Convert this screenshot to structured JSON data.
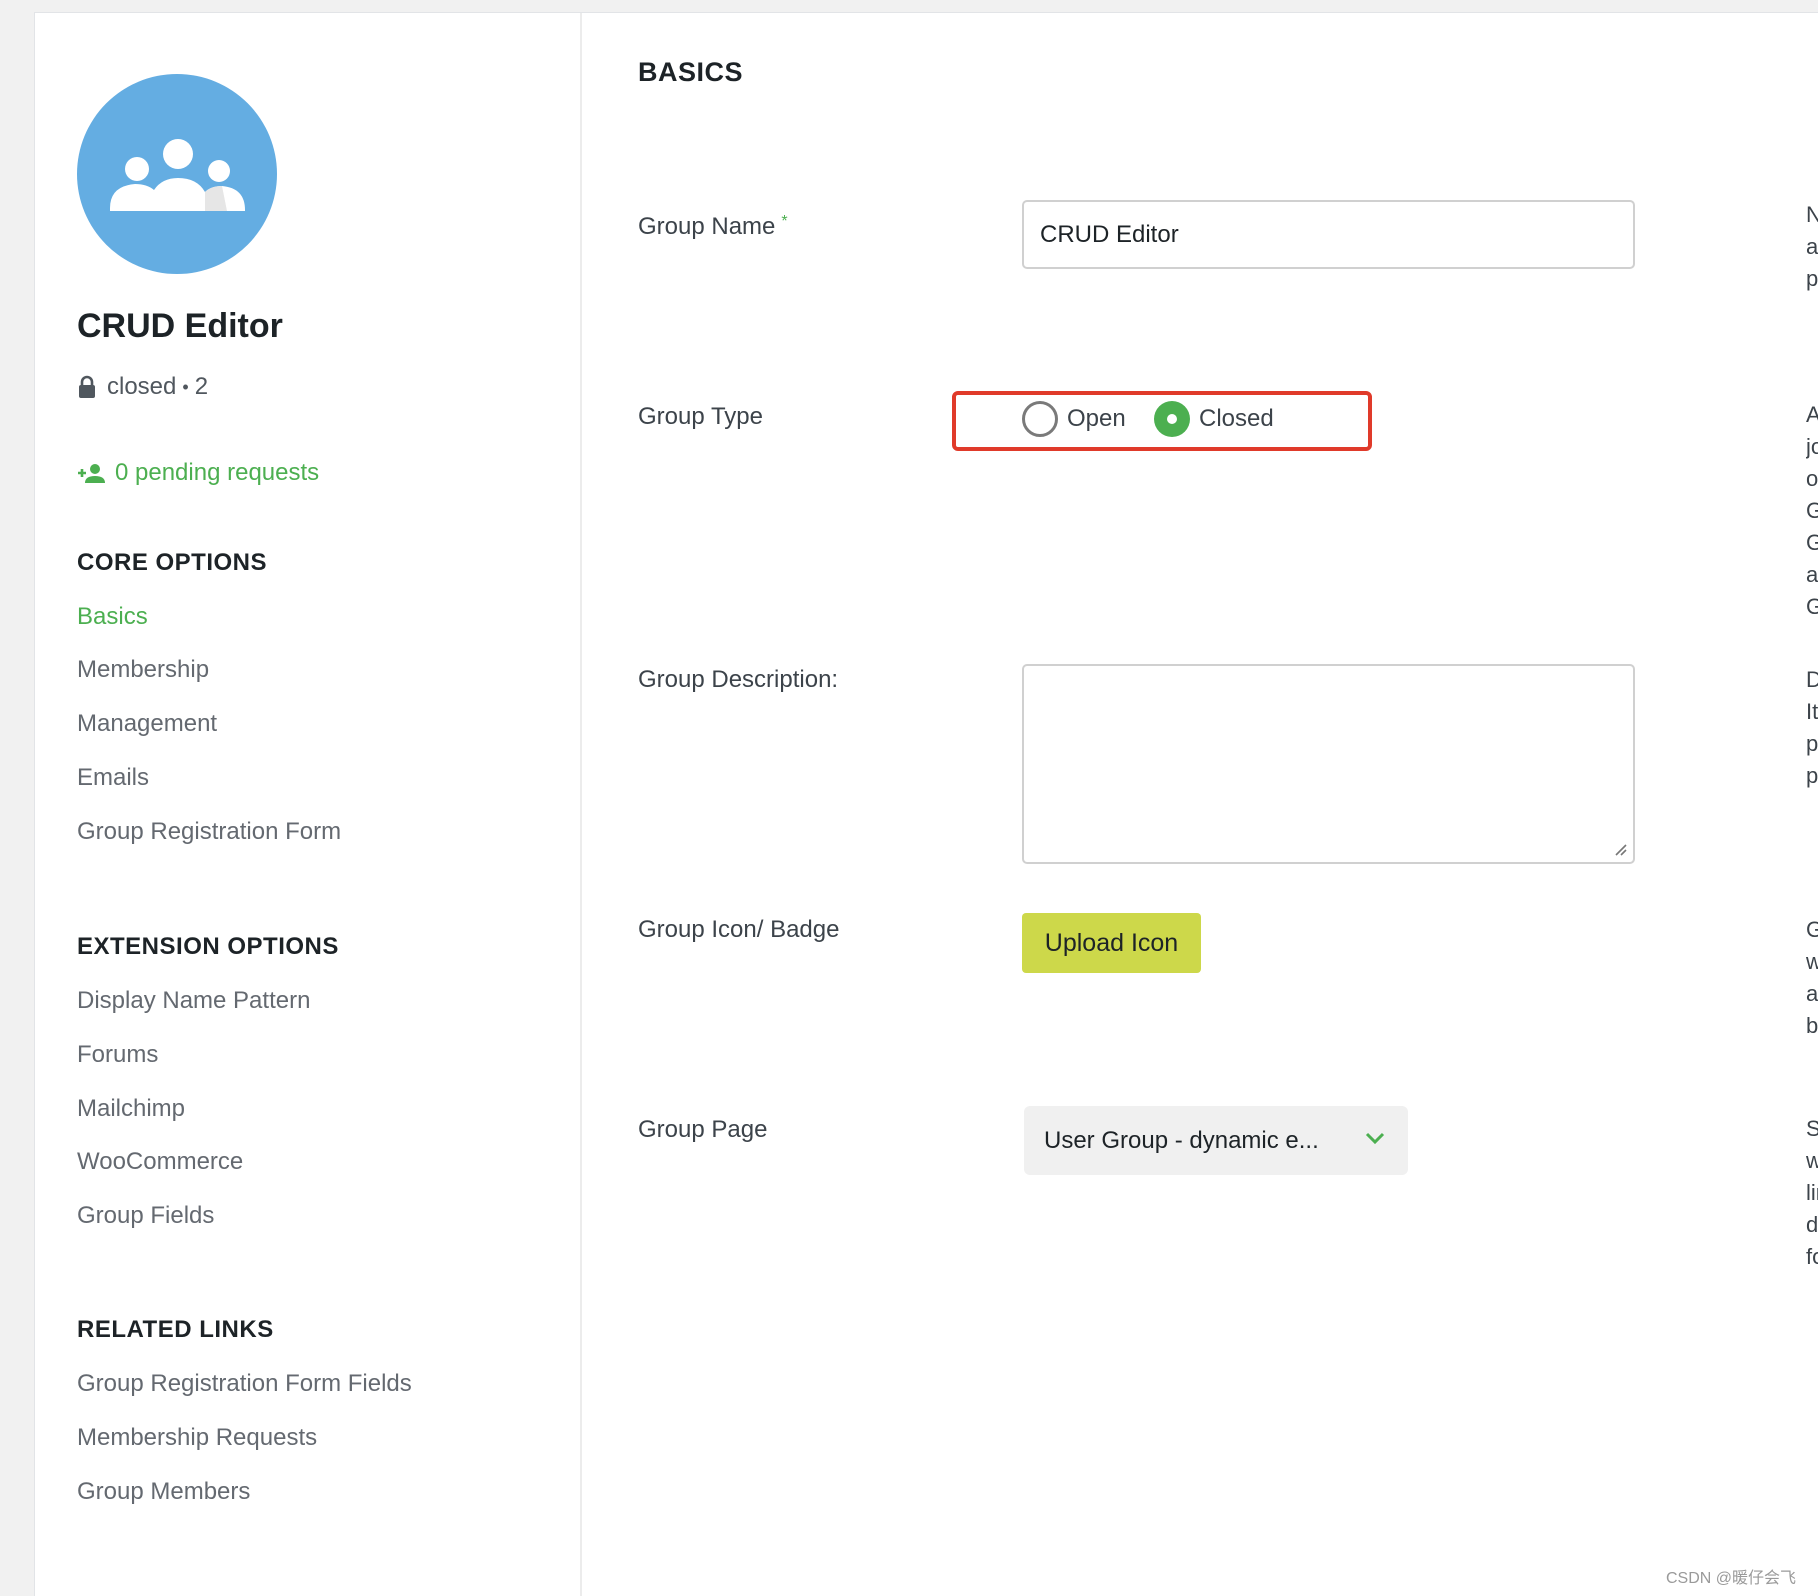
{
  "sidebar": {
    "group_name": "CRUD Editor",
    "status": "closed",
    "member_count": "2",
    "pending_requests": "0 pending requests",
    "core_options_title": "CORE OPTIONS",
    "core_options": [
      "Basics",
      "Membership",
      "Management",
      "Emails",
      "Group Registration Form"
    ],
    "extension_options_title": "EXTENSION OPTIONS",
    "extension_options": [
      "Display Name Pattern",
      "Forums",
      "Mailchimp",
      "WooCommerce",
      "Group Fields"
    ],
    "related_links_title": "RELATED LINKS",
    "related_links": [
      "Group Registration Form Fields",
      "Membership Requests",
      "Group Members"
    ]
  },
  "main": {
    "title": "BASICS",
    "group_name_label": "Group Name",
    "required_mark": "*",
    "group_name_value": "CRUD Editor",
    "group_type_label": "Group Type",
    "group_type_options": [
      "Open",
      "Closed"
    ],
    "group_type_selected": "Closed",
    "group_description_label": "Group Description:",
    "group_description_value": "",
    "group_icon_label": "Group Icon/ Badge",
    "upload_icon_label": "Upload Icon",
    "group_page_label": "Group Page",
    "group_page_value": "User Group - dynamic e..."
  },
  "help_text": {
    "group_name": [
      "Na",
      "ap",
      "pa"
    ],
    "group_type": [
      "An",
      "joi",
      "or",
      "Gr",
      "Gr",
      "ap",
      "Gr"
    ],
    "group_description": [
      "De",
      "It w",
      "pa",
      "pa"
    ],
    "group_icon": [
      "Gr",
      "wil",
      "an",
      "be"
    ],
    "group_page": [
      "Se",
      "wh",
      "lin",
      "dis",
      "fo"
    ]
  },
  "watermark": "CSDN @暖仔会飞",
  "colors": {
    "accent_green": "#4caf50",
    "avatar_blue": "#64ade2",
    "upload_button": "#cdd84a",
    "highlight_red": "#e03a2a"
  },
  "icons": {
    "avatar": "group-icon",
    "status": "lock-icon",
    "pending": "add-user-icon",
    "select": "chevron-down-icon"
  }
}
